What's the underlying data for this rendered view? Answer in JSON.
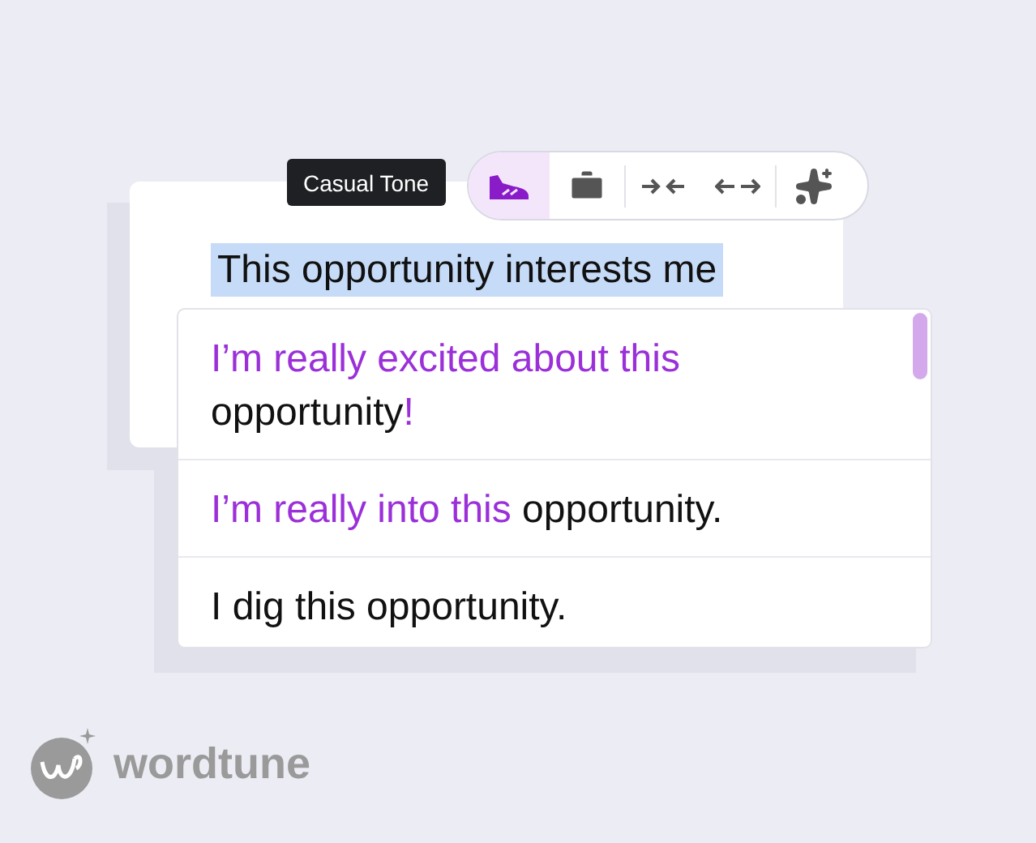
{
  "tooltip": {
    "text": "Casual Tone"
  },
  "toolbar": {
    "tools": [
      {
        "kind": "casual",
        "selected": true
      },
      {
        "kind": "formal",
        "selected": false
      },
      {
        "kind": "shorten",
        "selected": false
      },
      {
        "kind": "expand",
        "selected": false
      },
      {
        "kind": "rewrite",
        "selected": false
      }
    ]
  },
  "editor": {
    "selected_text": "This opportunity interests me"
  },
  "suggestions": [
    {
      "parts": [
        {
          "text": "I’m really excited about this",
          "changed": true
        },
        {
          "text": " opportunity",
          "changed": false
        },
        {
          "text": "!",
          "changed": true
        }
      ]
    },
    {
      "parts": [
        {
          "text": "I’m really into this",
          "changed": true
        },
        {
          "text": " opportunity.",
          "changed": false
        }
      ]
    },
    {
      "parts": [
        {
          "text": "I dig this opportunity.",
          "changed": false
        }
      ]
    }
  ],
  "logo": {
    "text": "wordtune"
  }
}
